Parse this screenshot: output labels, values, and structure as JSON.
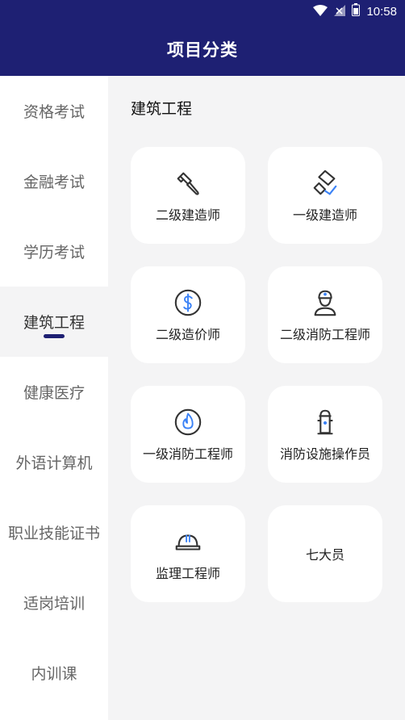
{
  "status_bar": {
    "time": "10:58",
    "icons": [
      "wifi-icon",
      "signal-icon",
      "battery-icon"
    ]
  },
  "header": {
    "title": "项目分类"
  },
  "sidebar": {
    "items": [
      {
        "label": "资格考试"
      },
      {
        "label": "金融考试"
      },
      {
        "label": "学历考试"
      },
      {
        "label": "建筑工程"
      },
      {
        "label": "健康医疗"
      },
      {
        "label": "外语计算机"
      },
      {
        "label": "职业技能证书"
      },
      {
        "label": "适岗培训"
      },
      {
        "label": "内训课"
      }
    ],
    "active_index": 3
  },
  "content": {
    "section_title": "建筑工程",
    "cards": [
      {
        "label": "二级建造师",
        "icon": "hammer-icon"
      },
      {
        "label": "一级建造师",
        "icon": "paint-roller-icon"
      },
      {
        "label": "二级造价师",
        "icon": "dollar-coin-icon"
      },
      {
        "label": "二级消防工程师",
        "icon": "firefighter-icon"
      },
      {
        "label": "一级消防工程师",
        "icon": "fire-badge-icon"
      },
      {
        "label": "消防设施操作员",
        "icon": "fire-hydrant-icon"
      },
      {
        "label": "监理工程师",
        "icon": "hard-hat-icon"
      },
      {
        "label": "七大员",
        "icon": ""
      }
    ]
  },
  "colors": {
    "primary": "#1e2073",
    "accent_blue": "#3b82f6",
    "background": "#f4f4f5",
    "card": "#ffffff"
  }
}
